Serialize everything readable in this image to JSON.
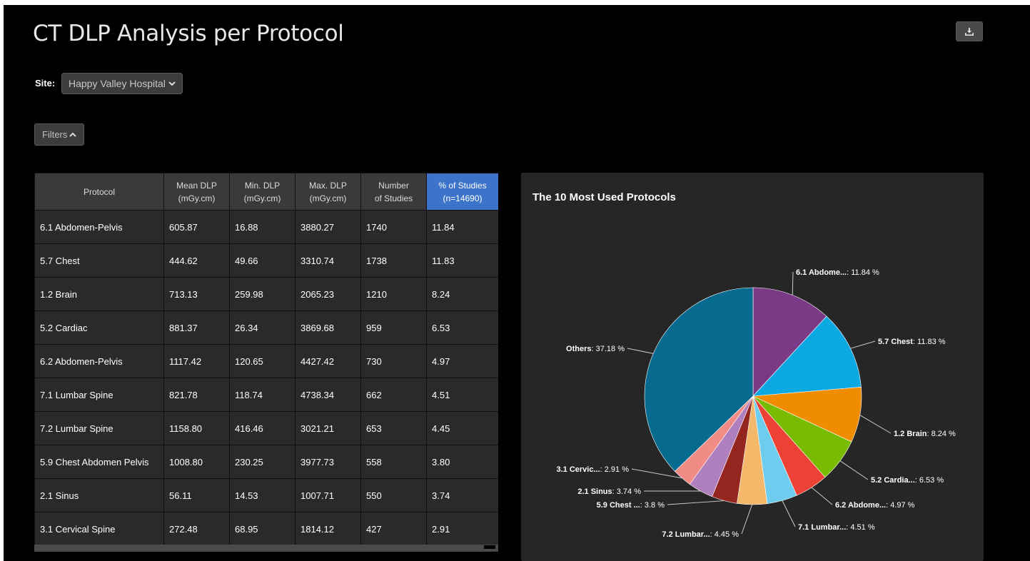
{
  "page": {
    "title": "CT DLP Analysis per Protocol"
  },
  "site": {
    "label": "Site:",
    "value": "Happy Valley Hospital"
  },
  "filters": {
    "label": "Filters"
  },
  "table": {
    "headers": [
      {
        "line1": "Protocol",
        "line2": ""
      },
      {
        "line1": "Mean DLP",
        "line2": "(mGy.cm)"
      },
      {
        "line1": "Min. DLP",
        "line2": "(mGy.cm)"
      },
      {
        "line1": "Max. DLP",
        "line2": "(mGy.cm)"
      },
      {
        "line1": "Number",
        "line2": "of Studies"
      },
      {
        "line1": "% of Studies",
        "line2": "(n=14690)"
      }
    ],
    "rows": [
      [
        "6.1 Abdomen-Pelvis",
        "605.87",
        "16.88",
        "3880.27",
        "1740",
        "11.84"
      ],
      [
        "5.7 Chest",
        "444.62",
        "49.66",
        "3310.74",
        "1738",
        "11.83"
      ],
      [
        "1.2 Brain",
        "713.13",
        "259.98",
        "2065.23",
        "1210",
        "8.24"
      ],
      [
        "5.2 Cardiac",
        "881.37",
        "26.34",
        "3869.68",
        "959",
        "6.53"
      ],
      [
        "6.2 Abdomen-Pelvis",
        "1117.42",
        "120.65",
        "4427.42",
        "730",
        "4.97"
      ],
      [
        "7.1 Lumbar Spine",
        "821.78",
        "118.74",
        "4738.34",
        "662",
        "4.51"
      ],
      [
        "7.2 Lumbar Spine",
        "1158.80",
        "416.46",
        "3021.21",
        "653",
        "4.45"
      ],
      [
        "5.9 Chest Abdomen Pelvis",
        "1008.80",
        "230.25",
        "3977.73",
        "558",
        "3.80"
      ],
      [
        "2.1 Sinus",
        "56.11",
        "14.53",
        "1007.71",
        "550",
        "3.74"
      ],
      [
        "3.1 Cervical Spine",
        "272.48",
        "68.95",
        "1814.12",
        "427",
        "2.91"
      ]
    ]
  },
  "chart_data": {
    "type": "pie",
    "title": "The 10 Most Used Protocols",
    "slices": [
      {
        "name": "6.1 Abdome...",
        "value": 11.84,
        "label": "11.84 %",
        "color": "#7b3a86"
      },
      {
        "name": "5.7 Chest",
        "value": 11.83,
        "label": "11.83 %",
        "color": "#0ba8e2"
      },
      {
        "name": "1.2 Brain",
        "value": 8.24,
        "label": "8.24 %",
        "color": "#ef8c00"
      },
      {
        "name": "5.2 Cardia...",
        "value": 6.53,
        "label": "6.53 %",
        "color": "#78bb00"
      },
      {
        "name": "6.2 Abdome...",
        "value": 4.97,
        "label": "4.97 %",
        "color": "#ee4135"
      },
      {
        "name": "7.1 Lumbar...",
        "value": 4.51,
        "label": "4.51 %",
        "color": "#6ecdee"
      },
      {
        "name": "7.2 Lumbar...",
        "value": 4.45,
        "label": "4.45 %",
        "color": "#f4b86a"
      },
      {
        "name": "5.9 Chest ...",
        "value": 3.8,
        "label": "3.8 %",
        "color": "#95261f"
      },
      {
        "name": "2.1 Sinus",
        "value": 3.74,
        "label": "3.74 %",
        "color": "#b07fbe"
      },
      {
        "name": "3.1 Cervic...",
        "value": 2.91,
        "label": "2.91 %",
        "color": "#f08b86"
      },
      {
        "name": "Others",
        "value": 37.18,
        "label": "37.18 %",
        "color": "#076a8f"
      }
    ]
  }
}
